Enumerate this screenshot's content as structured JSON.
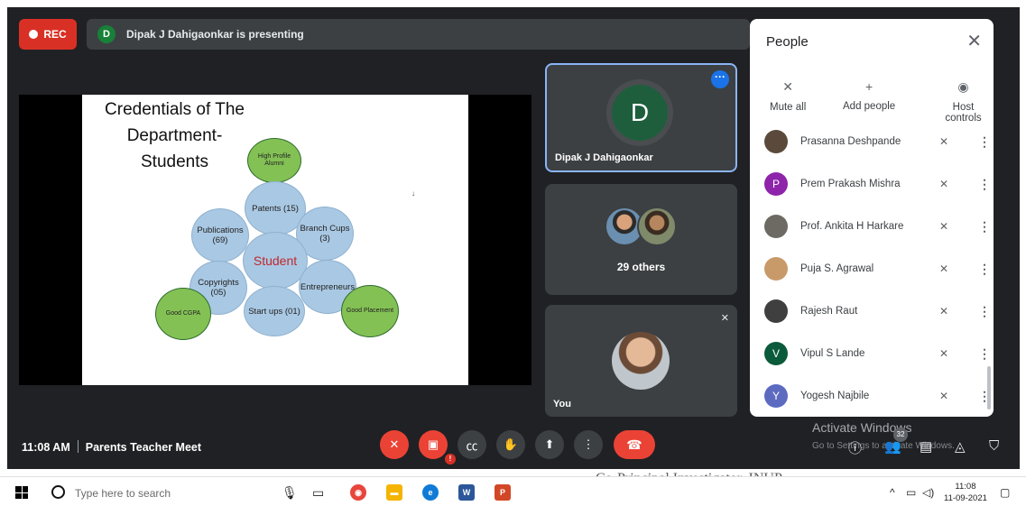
{
  "top_bar": {
    "rec_label": "REC",
    "presenter_initial": "D",
    "presenting_text": "Dipak J Dahigaonkar is presenting"
  },
  "slide": {
    "title": "Credentials of The Department- Students",
    "center_label": "Student",
    "items": {
      "high_profile": "High Profile Alumni",
      "patents": "Patents (15)",
      "branch_cups": "Branch Cups (3)",
      "publications": "Publications (69)",
      "entrepreneurs": "Entrepreneurs",
      "copyrights": "Copyrights (05)",
      "startups": "Start ups (01)",
      "good_cgpa": "Good CGPA",
      "good_placement": "Good Placement"
    }
  },
  "tiles": {
    "presenter": {
      "initial": "D",
      "name": "Dipak J Dahigaonkar"
    },
    "others": {
      "label": "29 others"
    },
    "self": {
      "name": "You"
    }
  },
  "people_panel": {
    "title": "People",
    "controls": {
      "mute_all": "Mute all",
      "add_people": "Add people",
      "host_controls": "Host controls"
    },
    "participants": [
      {
        "name": "Prasanna Deshpande",
        "initial": "",
        "color": "#5b4a3b"
      },
      {
        "name": "Prem Prakash Mishra",
        "initial": "P",
        "color": "#8e24aa"
      },
      {
        "name": "Prof. Ankita H Harkare",
        "initial": "",
        "color": "#6d6a63"
      },
      {
        "name": "Puja S. Agrawal",
        "initial": "",
        "color": "#c89a6a"
      },
      {
        "name": "Rajesh Raut",
        "initial": "",
        "color": "#3f3f3f"
      },
      {
        "name": "Vipul S Lande",
        "initial": "V",
        "color": "#0b5a3a"
      },
      {
        "name": "Yogesh Najbile",
        "initial": "Y",
        "color": "#5c6bc0"
      }
    ]
  },
  "bottom_bar": {
    "time": "11:08 AM",
    "meeting_name": "Parents Teacher Meet",
    "participant_count": "32"
  },
  "watermark": {
    "line1": "Activate Windows",
    "line2": "Go to Settings to activate Windows."
  },
  "taskbar": {
    "search_placeholder": "Type here to search",
    "background_text": "Co-Principal Investigator, INUP",
    "clock_time": "11:08",
    "clock_date": "11-09-2021"
  }
}
